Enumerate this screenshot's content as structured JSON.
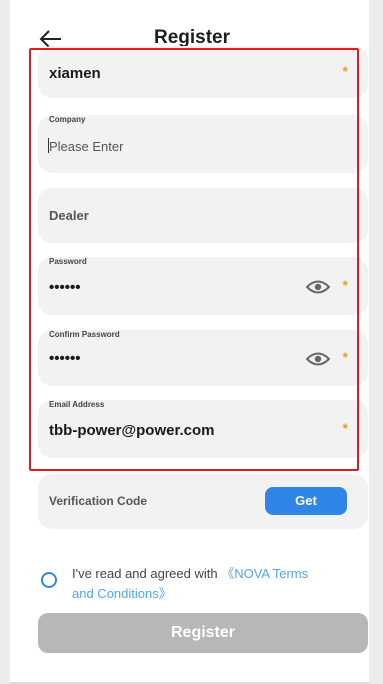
{
  "header": {
    "title": "Register",
    "back_icon": "arrow-left-icon"
  },
  "form": {
    "city_value": "xiamen",
    "required_mark": "*",
    "company": {
      "label": "Company",
      "placeholder": "Please Enter"
    },
    "dealer": {
      "label": "Dealer"
    },
    "password": {
      "label": "Password",
      "value": "••••••"
    },
    "confirm_password": {
      "label": "Confirm Password",
      "value": "••••••"
    },
    "email": {
      "label": "Email Address",
      "value": "tbb-power@power.com"
    },
    "verification": {
      "label": "Verification Code",
      "button": "Get"
    }
  },
  "agreement": {
    "text": "I've read and agreed with ",
    "link": "《NOVA Terms and Conditions》"
  },
  "register_button": "Register",
  "colors": {
    "highlight": "#e01b22",
    "accent": "#2f86e8",
    "required": "#f0a020",
    "link": "#58a4e6",
    "disabled_button": "#b7b7b7"
  }
}
